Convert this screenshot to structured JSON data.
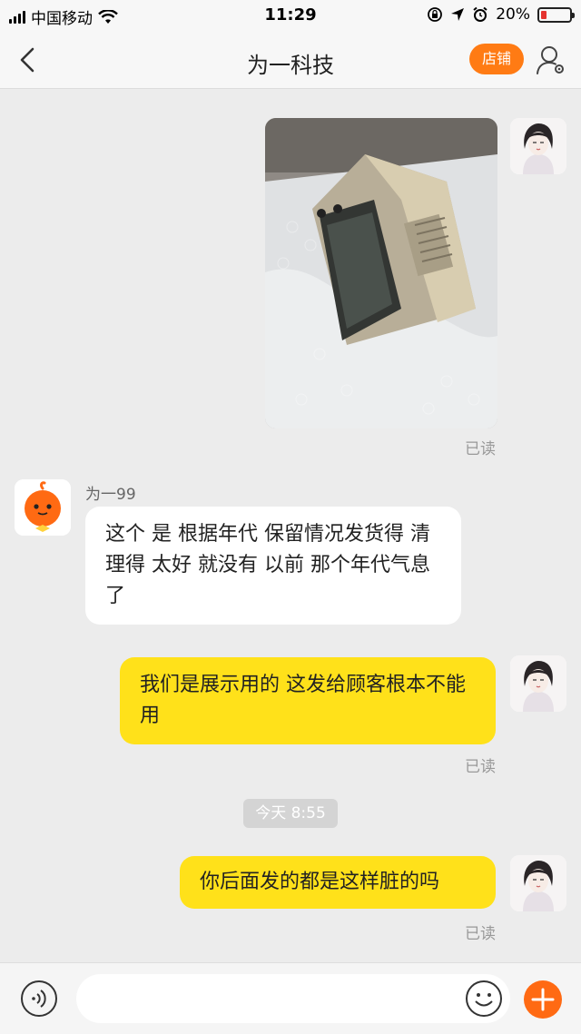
{
  "status_bar": {
    "carrier": "中国移动",
    "time": "11:29",
    "battery_percent": "20%",
    "battery_level": 0.2,
    "icons": [
      "signal-icon",
      "wifi-icon",
      "lock-rotation-icon",
      "location-icon",
      "alarm-icon",
      "battery-icon"
    ]
  },
  "nav": {
    "title": "为一科技",
    "shop_label": "店铺",
    "icons": [
      "back-icon",
      "user-settings-icon"
    ]
  },
  "messages": {
    "read_label_1": "已读",
    "seller_name": "为一99",
    "seller_message": "这个 是 根据年代  保留情况发货得   清理得  太好  就没有 以前 那个年代气息了",
    "self_message_1": "我们是展示用的 这发给顾客根本不能用",
    "read_label_2": "已读",
    "time_divider": "今天 8:55",
    "self_message_2": "你后面发的都是这样脏的吗",
    "read_label_3": "已读"
  },
  "input_bar": {
    "placeholder": "",
    "icons": [
      "voice-icon",
      "emoji-icon",
      "plus-icon"
    ]
  },
  "colors": {
    "accent_orange": "#ff7b14",
    "self_bubble": "#ffe11a",
    "background": "#ececec"
  }
}
